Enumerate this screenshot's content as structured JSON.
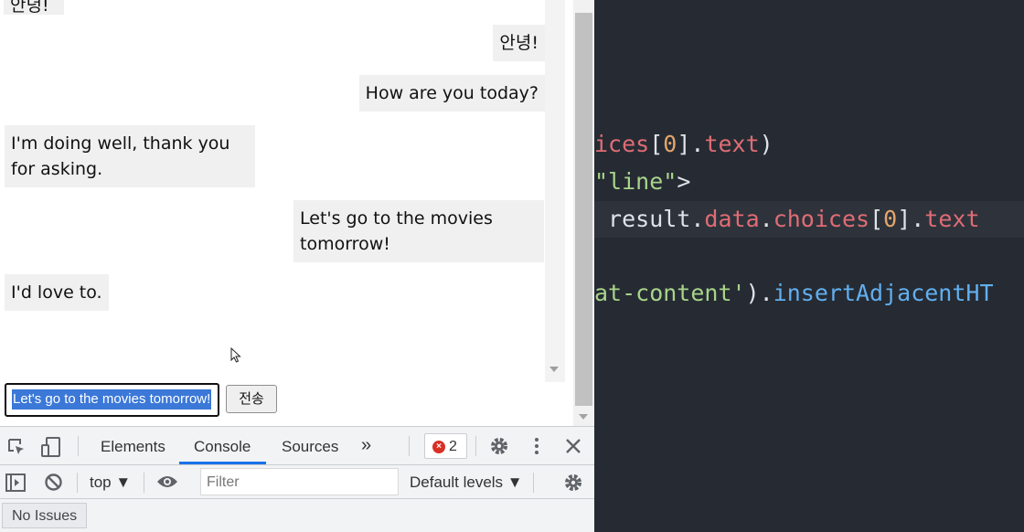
{
  "chat": {
    "messages": [
      {
        "text": "안녕!",
        "side": "left"
      },
      {
        "text": "안녕!",
        "side": "right"
      },
      {
        "text": "How are you today?",
        "side": "right"
      },
      {
        "text": "I'm doing well, thank you for asking.",
        "side": "left"
      },
      {
        "text": "Let's go to the movies tomorrow!",
        "side": "right"
      },
      {
        "text": "I'd love to.",
        "side": "left"
      }
    ],
    "input_value": "Let's go to the movies tomorrow!",
    "send_label": "전송"
  },
  "devtools": {
    "tabs": [
      {
        "label": "Elements",
        "active": false
      },
      {
        "label": "Console",
        "active": true
      },
      {
        "label": "Sources",
        "active": false
      }
    ],
    "more_tabs": "»",
    "error_count": "2",
    "context": "top ▼",
    "filter_placeholder": "Filter",
    "levels": "Default levels ▼",
    "issues": "No Issues"
  },
  "editor": {
    "lines": [
      [
        {
          "t": "ices",
          "c": "red"
        },
        {
          "t": "[",
          "c": "white"
        },
        {
          "t": "0",
          "c": "orange"
        },
        {
          "t": "].",
          "c": "white"
        },
        {
          "t": "text",
          "c": "red"
        },
        {
          "t": ")",
          "c": "white"
        }
      ],
      [
        {
          "t": "\"line\"",
          "c": "green"
        },
        {
          "t": ">",
          "c": "white"
        }
      ],
      [
        {
          "t": " result.",
          "c": "white"
        },
        {
          "t": "data",
          "c": "red"
        },
        {
          "t": ".",
          "c": "white"
        },
        {
          "t": "choices",
          "c": "red"
        },
        {
          "t": "[",
          "c": "white"
        },
        {
          "t": "0",
          "c": "orange"
        },
        {
          "t": "].",
          "c": "white"
        },
        {
          "t": "text",
          "c": "red"
        }
      ],
      [
        {
          "t": "at-content'",
          "c": "green"
        },
        {
          "t": ").",
          "c": "white"
        },
        {
          "t": "insertAdjacentHT",
          "c": "blue"
        }
      ]
    ]
  },
  "colors": {
    "editor_bg": "#262b33",
    "devtools_accent": "#1a73e8",
    "selection": "#3b78d8",
    "error": "#d93025"
  }
}
